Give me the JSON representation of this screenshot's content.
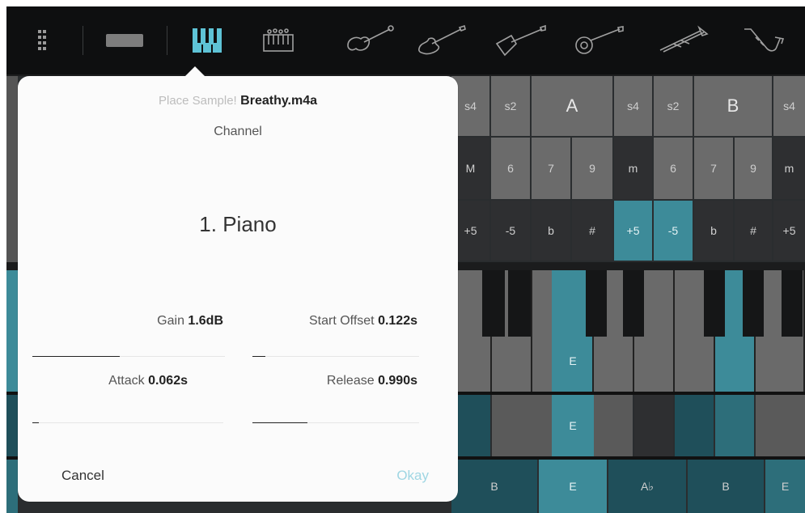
{
  "toolbar": {
    "tools": [
      {
        "icon": "drag-handle-icon"
      },
      {
        "icon": "keyboard-bar-icon"
      },
      {
        "icon": "piano-keys-icon",
        "active": true
      },
      {
        "icon": "chord-keys-icon"
      },
      {
        "icon": "violin-icon"
      },
      {
        "icon": "electric-guitar-icon"
      },
      {
        "icon": "flying-v-guitar-icon"
      },
      {
        "icon": "banjo-icon"
      },
      {
        "icon": "trumpet-icon"
      },
      {
        "icon": "saxophone-icon"
      }
    ],
    "active_color": "#5ec3d6"
  },
  "popover": {
    "sample_prefix": "Place Sample!",
    "sample_file": "Breathy.m4a",
    "channel_label": "Channel",
    "channel_value": "1. Piano",
    "gain_label": "Gain",
    "gain_value": "1.6dB",
    "start_offset_label": "Start Offset",
    "start_offset_value": "0.122s",
    "attack_label": "Attack",
    "attack_value": "0.062s",
    "release_label": "Release",
    "release_value": "0.990s",
    "cancel_label": "Cancel",
    "okay_label": "Okay"
  },
  "grid": {
    "row1": [
      "s4",
      "s2",
      "A",
      "s4",
      "s2",
      "B",
      "s4"
    ],
    "row2": [
      "M",
      "6",
      "7",
      "9",
      "m",
      "6",
      "7",
      "9",
      "m"
    ],
    "row3": [
      "+5",
      "-5",
      "b",
      "#",
      "+5",
      "-5",
      "b",
      "#",
      "+5"
    ],
    "piano_key_label": "E",
    "row5_label": "E",
    "bottom_row": [
      "B",
      "E",
      "A♭",
      "B",
      "E"
    ]
  },
  "colors": {
    "teal": "#3d8b99",
    "toolbar_bg": "#0e0f10",
    "okay_color": "#9fd6e3"
  }
}
